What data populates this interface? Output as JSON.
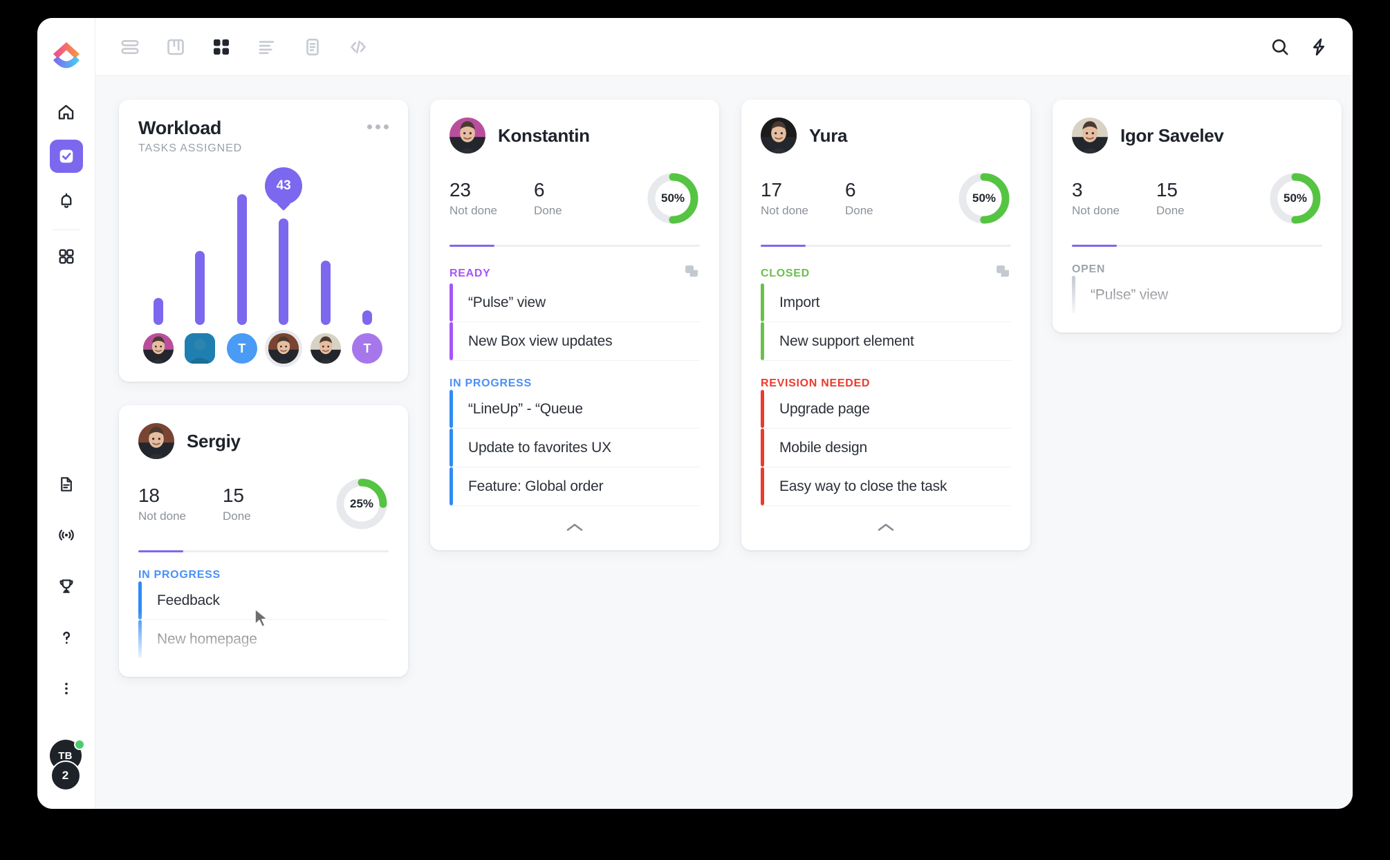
{
  "topbar": {
    "views": [
      {
        "name": "list-view-icon",
        "label": "List",
        "active": false
      },
      {
        "name": "board-view-icon",
        "label": "Board",
        "active": false
      },
      {
        "name": "box-view-icon",
        "label": "Box",
        "active": true
      },
      {
        "name": "activity-view-icon",
        "label": "Activity",
        "active": false
      },
      {
        "name": "doc-view-icon",
        "label": "Doc",
        "active": false
      },
      {
        "name": "embed-view-icon",
        "label": "Embed",
        "active": false
      }
    ],
    "actions": [
      {
        "name": "search-icon",
        "label": "Search"
      },
      {
        "name": "lightning-icon",
        "label": "Quick actions"
      }
    ]
  },
  "sidebar": {
    "logo_label": "ClickUp",
    "top_items": [
      {
        "name": "home-icon",
        "label": "Home",
        "active": false
      },
      {
        "name": "tasks-check-icon",
        "label": "Tasks",
        "active": true
      },
      {
        "name": "bell-icon",
        "label": "Notifications",
        "active": false
      }
    ],
    "mid_items": [
      {
        "name": "dashboard-grid-icon",
        "label": "Dashboards",
        "active": false
      }
    ],
    "bottom_items": [
      {
        "name": "document-icon",
        "label": "Docs"
      },
      {
        "name": "pulse-broadcast-icon",
        "label": "Pulse"
      },
      {
        "name": "trophy-icon",
        "label": "Goals"
      },
      {
        "name": "help-question-icon",
        "label": "Help"
      },
      {
        "name": "more-vertical-icon",
        "label": "More"
      }
    ],
    "user": {
      "initials": "TB",
      "notification_count": "2",
      "status": "online"
    }
  },
  "colors": {
    "purple": "#7b68ee",
    "green": "#56c443",
    "blue": "#4a90f7",
    "red": "#ec3a2c",
    "gray": "#b6bbc4",
    "track": "#e7e9ed"
  },
  "workload": {
    "title": "Workload",
    "subtitle": "TASKS ASSIGNED",
    "menu_label": "More options"
  },
  "chart_data": {
    "type": "bar",
    "title": "Workload",
    "subtitle": "TASKS ASSIGNED",
    "xlabel": "",
    "ylabel": "Tasks assigned",
    "categories": [
      "Konstantin",
      "Team member 2",
      "T",
      "Sergiy",
      "Igor Savelev",
      "T"
    ],
    "values": [
      11,
      30,
      53,
      43,
      26,
      6
    ],
    "highlighted_index": 3,
    "highlight_label": "43",
    "ylim": [
      0,
      56
    ],
    "grid": false,
    "legend": false,
    "bar_color": "#7b68ee",
    "avatars": [
      {
        "name": "avatar-konstantin",
        "kind": "photo",
        "tone": "#b94f9c",
        "initial": "",
        "ring": false,
        "square": false
      },
      {
        "name": "avatar-member-2",
        "kind": "photo",
        "tone": "#1f7fb0",
        "initial": "",
        "ring": false,
        "square": true
      },
      {
        "name": "avatar-initial-t-blue",
        "kind": "initial",
        "tone": "#4a9bf5",
        "initial": "T",
        "ring": false,
        "square": false
      },
      {
        "name": "avatar-sergiy",
        "kind": "photo",
        "tone": "#7a4432",
        "initial": "",
        "ring": true,
        "square": false
      },
      {
        "name": "avatar-igor",
        "kind": "photo",
        "tone": "#d8d2c4",
        "initial": "",
        "ring": false,
        "square": false
      },
      {
        "name": "avatar-initial-t-purple",
        "kind": "initial",
        "tone": "#a577ea",
        "initial": "T",
        "ring": false,
        "square": false
      }
    ]
  },
  "members": [
    {
      "id": "konstantin",
      "name": "Konstantin",
      "avatar_tone": "#b94f9c",
      "not_done": "23",
      "not_done_label": "Not done",
      "done": "6",
      "done_label": "Done",
      "percent": "50%",
      "percent_value": 50,
      "progress_pct": 18,
      "faded": false,
      "collapse_label": "Collapse",
      "sections": [
        {
          "title": "READY",
          "color": "#a855f7",
          "stripe": "#a855f7",
          "copy_icon": "duplicate-icon",
          "tasks": [
            "“Pulse” view",
            "New Box view updates"
          ]
        },
        {
          "title": "IN PROGRESS",
          "color": "#4a90f7",
          "stripe": "#2f8bf5",
          "copy_icon": "",
          "tasks": [
            "“LineUp” - “Queue",
            "Update to favorites UX",
            "Feature: Global order"
          ]
        }
      ]
    },
    {
      "id": "yura",
      "name": "Yura",
      "avatar_tone": "#1b1b1b",
      "not_done": "17",
      "not_done_label": "Not done",
      "done": "6",
      "done_label": "Done",
      "percent": "50%",
      "percent_value": 50,
      "progress_pct": 18,
      "faded": false,
      "collapse_label": "Collapse",
      "sections": [
        {
          "title": "CLOSED",
          "color": "#6bbf4c",
          "stripe": "#6bbf4c",
          "copy_icon": "duplicate-icon",
          "tasks": [
            "Import",
            "New support element"
          ]
        },
        {
          "title": "REVISION NEEDED",
          "color": "#ec3a2c",
          "stripe": "#ec3a2c",
          "copy_icon": "",
          "tasks": [
            "Upgrade page",
            "Mobile design",
            "Easy way to close the task"
          ]
        }
      ]
    },
    {
      "id": "igor-savelev",
      "name": "Igor Savelev",
      "avatar_tone": "#d8d2c4",
      "not_done": "3",
      "not_done_label": "Not done",
      "done": "15",
      "done_label": "Done",
      "percent": "50%",
      "percent_value": 50,
      "progress_pct": 18,
      "faded": true,
      "collapse_label": "Collapse",
      "sections": [
        {
          "title": "OPEN",
          "color": "#9aa0aa",
          "stripe": "#b6bbc4",
          "copy_icon": "",
          "tasks": [
            "“Pulse” view"
          ]
        }
      ]
    },
    {
      "id": "sergiy",
      "name": "Sergiy",
      "avatar_tone": "#7a4432",
      "not_done": "18",
      "not_done_label": "Not done",
      "done": "15",
      "done_label": "Done",
      "percent": "25%",
      "percent_value": 25,
      "progress_pct": 18,
      "faded": true,
      "collapse_label": "Collapse",
      "sections": [
        {
          "title": "IN PROGRESS",
          "color": "#4a90f7",
          "stripe": "#2f8bf5",
          "copy_icon": "",
          "tasks": [
            "Feedback",
            "New homepage"
          ]
        }
      ]
    }
  ]
}
